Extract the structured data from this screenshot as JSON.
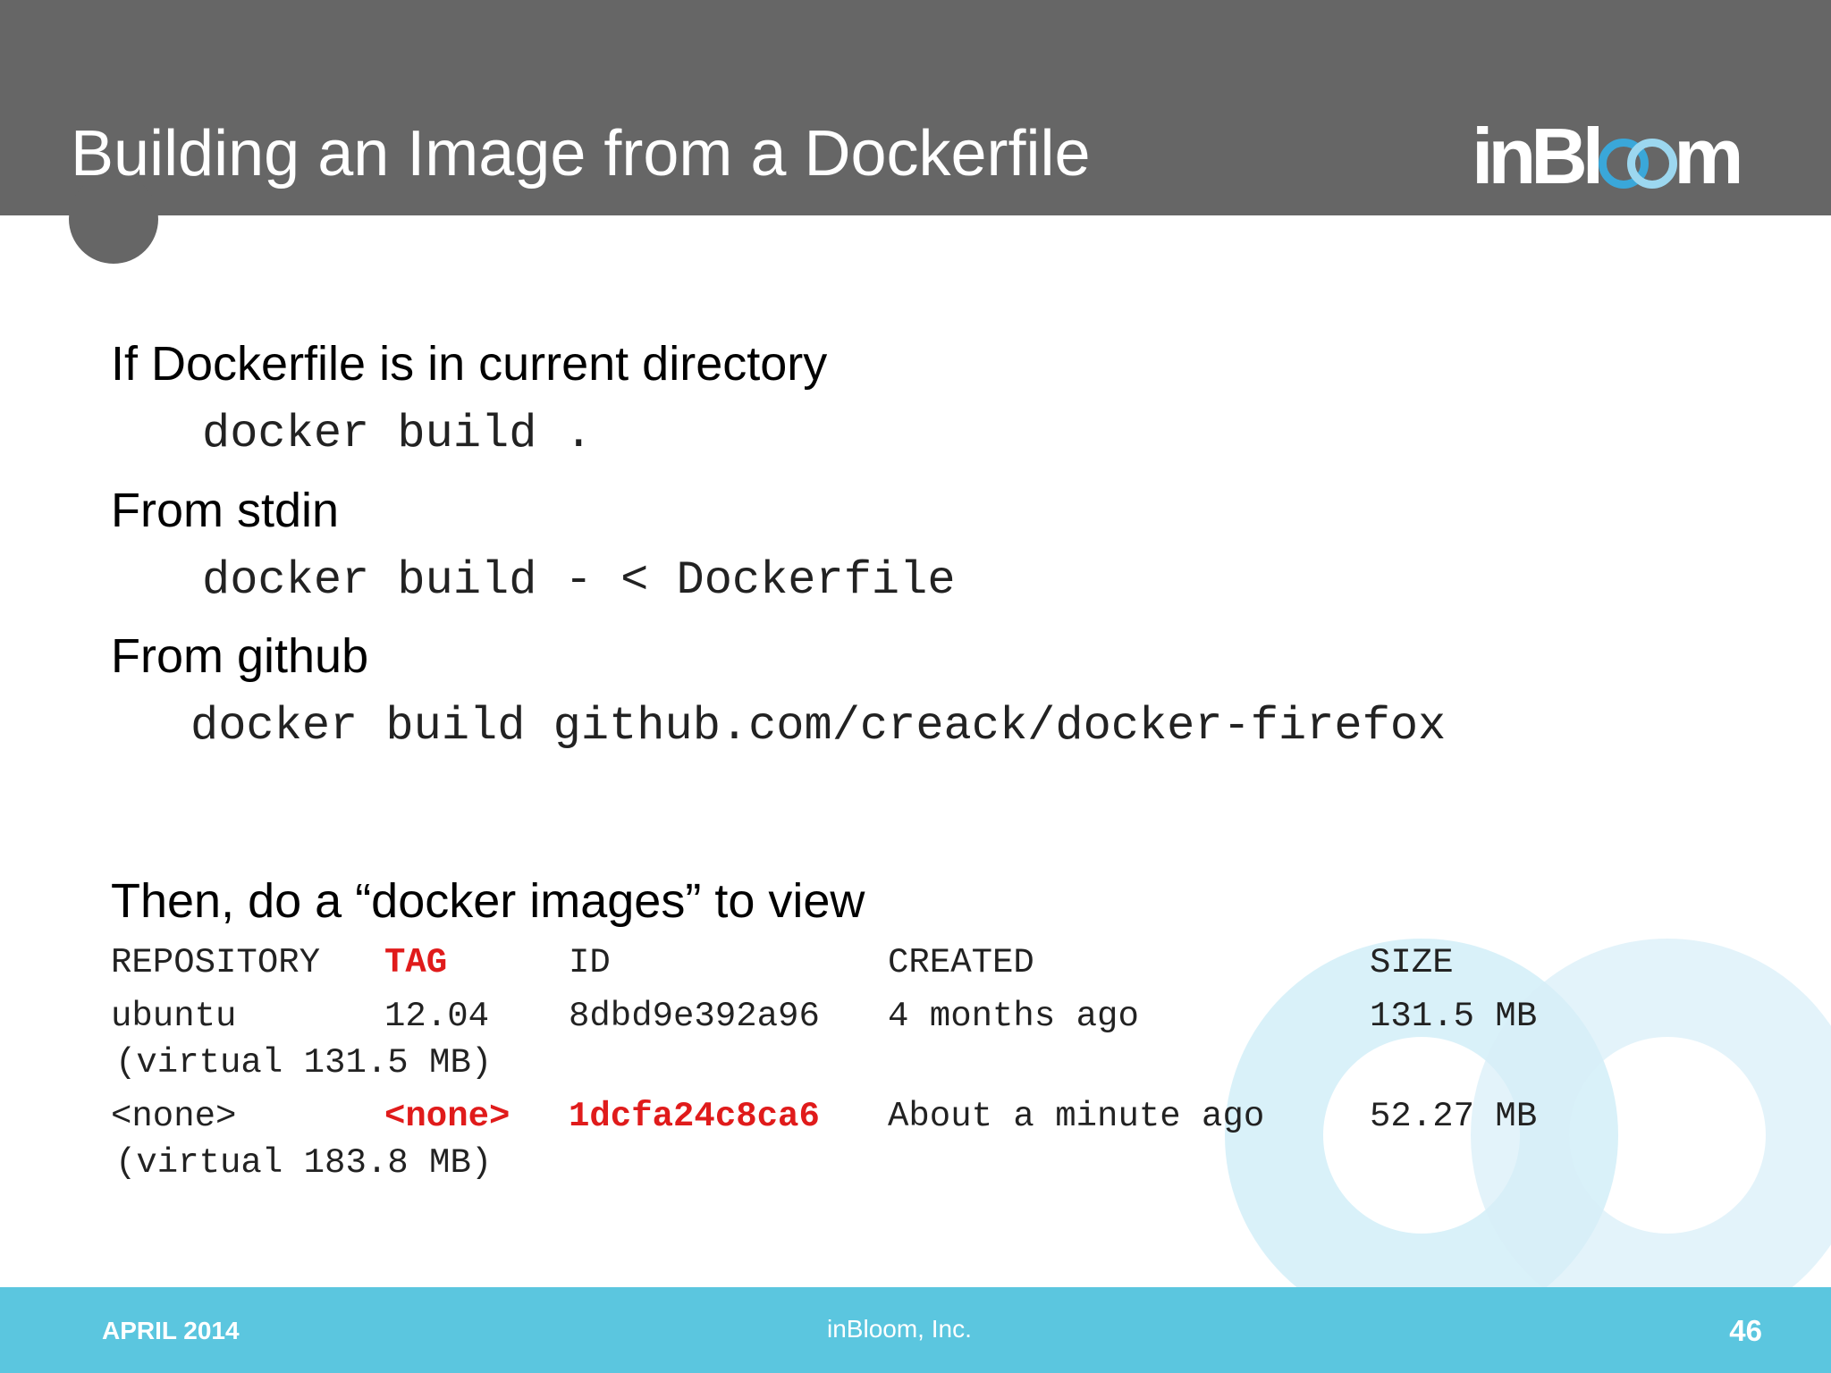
{
  "slide": {
    "title": "Building an Image from a Dockerfile",
    "logo_text": "inBloom",
    "colors": {
      "header_bg": "#666666",
      "footer_bg": "#5bc6df",
      "highlight_red": "#e01b1b",
      "watermark_blue": "#c9ebf6"
    }
  },
  "content": {
    "items": [
      {
        "label": "If Dockerfile is in current directory",
        "command": "docker build ."
      },
      {
        "label": "From stdin",
        "command": "docker build - < Dockerfile"
      },
      {
        "label": "From github",
        "command": "docker build github.com/creack/docker-firefox"
      }
    ],
    "images_heading": "Then, do a “docker images” to view"
  },
  "images_table": {
    "headers": [
      "REPOSITORY",
      "TAG",
      "ID",
      "CREATED",
      "SIZE"
    ],
    "rows": [
      {
        "repository": "ubuntu",
        "tag": "12.04",
        "id": "8dbd9e392a96",
        "created": "4 months ago",
        "size": "131.5 MB",
        "virtual": "(virtual 131.5 MB)"
      },
      {
        "repository": "<none>",
        "tag": "<none>",
        "id": "1dcfa24c8ca6",
        "created": "About a minute ago",
        "size": "52.27 MB",
        "virtual": "(virtual 183.8 MB)"
      }
    ]
  },
  "footer": {
    "date": "APRIL 2014",
    "company": "inBloom, Inc.",
    "page_number": "46"
  }
}
